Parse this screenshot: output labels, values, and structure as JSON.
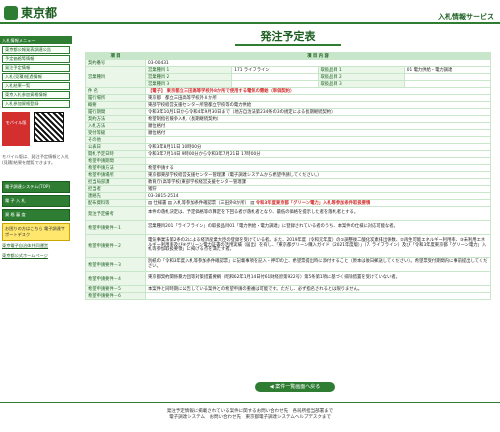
{
  "header": {
    "logo": "東京都",
    "service": "入札情報サービス"
  },
  "sidebar": {
    "head": "入札情報メニュー",
    "items": [
      "東京都公報発表調達公告",
      "予定価格等情報",
      "発注予定情報",
      "入札(見積)経過情報",
      "入札結果一覧",
      "東京入札参加資格情報",
      "入札参加資格登録"
    ],
    "mobile": "モバイル版",
    "note": "モバイル版は、発注予定情報と入札(見積)結果を閲覧できます。",
    "link1": "電子調達システム(TOP)",
    "link2": "電 子 入 札",
    "link3": "資 格 審 査",
    "yellow": "お困りの方はこちら 電子調達サポートデスク",
    "bottom": "東京電子自治体共同運営",
    "bottom2": "東京都公式ホームページ"
  },
  "page": {
    "title": "発注予定表",
    "back": "◀ 案件一覧画面へ戻る",
    "footer1": "発注予定情報に掲載されている案件に関するお問い合わせ先　各局所担当部署まで",
    "footer2": "電子調達システム　お問い合わせ先　東京都電子調達システムヘルプデスクまで"
  },
  "table": {
    "header": [
      "項 目",
      "項 目 内 容"
    ],
    "rows": [
      [
        "契約番号",
        "03-00431"
      ],
      [
        "営業種目",
        "営業種目 1",
        "171 ライフライン",
        "取扱品目 1",
        "01 電力供給・電力調達"
      ],
      [
        "",
        "営業種目 2",
        "",
        "取扱品目 2",
        ""
      ],
      [
        "",
        "営業種目 3",
        "",
        "取扱品目 3",
        ""
      ],
      [
        "件 名",
        "【電子】 東京都立三田高等学校外8か所で使用する電気の需給（単価契約）"
      ],
      [
        "履行場所",
        "東京都　都立三田高等学校外８か所"
      ],
      [
        "概要",
        "東部学校経営支援センター所管都立学校等の電力供給"
      ],
      [
        "履行期間",
        "令和3年10月1日から令和4年9月30日まで（地方自治法第234条の3の規定による長期継続契約）"
      ],
      [
        "契約方法",
        "希望制指名競争入札（長期継続契約）"
      ],
      [
        "入札方法",
        "順位格付"
      ],
      [
        "受付等級",
        "順位格付"
      ],
      [
        "その他",
        ""
      ],
      [
        "公表日",
        "令和3年8月11日 10時00分"
      ],
      [
        "開札予定日時",
        "令和3年7月14日 9時00分から令和3年7月21日 17時00分"
      ],
      [
        "希望申請期間",
        ""
      ],
      [
        "希望申請方法",
        "希望申請する"
      ],
      [
        "希望申請場所",
        "東京都東部学校経営支援センター管理課（電子調達システムから希望申請してください。）"
      ],
      [
        "担当局部課",
        "教育庁(高等学校)東部学校経営支援センター管理課"
      ],
      [
        "担当者",
        "猪狩"
      ],
      [
        "連絡先",
        "03-3815-2514"
      ],
      [
        "配布資料等",
        "仕様書",
        "入札等参加条件確認票（三田外8か所）",
        "令和3年度東京都「グリーン電力」入札等参加条件取扱要領"
      ],
      [
        "発注予定備考",
        "本件の落札決定は、予定価格等の算定を下回る者が落札者となり、最低の価格を提示した者を落札者とする。"
      ],
      [
        "希望申請要件－1",
        "営業種目201「ライフライン」の取扱品目01「電力供給・電力調達」に登録されている者のうち、本案件の仕様に対応可能な者。"
      ],
      [
        "希望申請要件－2",
        "電気事業法第2条の2による経済産業大臣の登録を受けている者。また、2019年度（令和元年度）の①調整後二酸化炭素排出係数、②再生可能エネルギー利用率、③未利用エネルギー利用率及び④グリーン電力証書の活用実績（届出）を有し、「東京都グリーン購入ガイド（2021年度版）」（7. ライフライン）及び「令和3年度東京都「グリーン電力」入札等参加取扱要領」に掲げる点を満たす者。"
      ],
      [
        "希望申請要件－3",
        "別紙の「令和3年度入札等参加条件確認票」に記載事項を記入・押印の上、希望票提出時に添付すること（原本は後日郵送してください）。希望票受付期間内に事前提出してください。"
      ],
      [
        "希望申請要件－4",
        "東京都契約関係暴力団等対策措置要綱（昭和62年1月14日付61財経庶第922号）第5条第1項に基づく排除措置を受けていない者。"
      ],
      [
        "希望申請要件－5",
        "本案件と同時期に公告している案件との希望申請の重複は可能です。ただし、必ず指名されるとは限りません。"
      ],
      [
        "希望申請要件－6",
        ""
      ]
    ]
  }
}
